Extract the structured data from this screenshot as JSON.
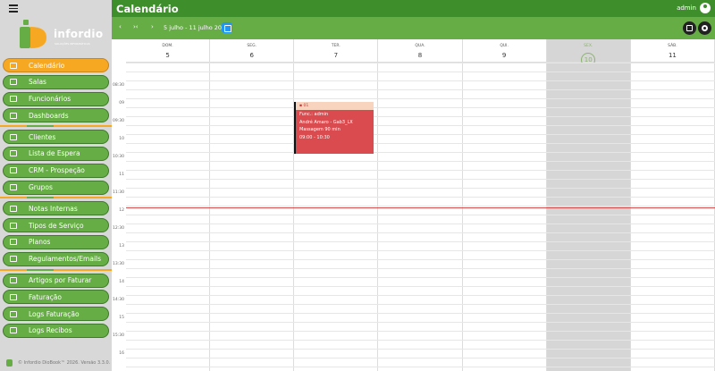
{
  "header": {
    "title": "Calendário",
    "user": "admin"
  },
  "toolbar": {
    "prev_icon": "chevron-left-icon",
    "today_icon": "collapse-icon",
    "next_icon": "chevron-right-icon",
    "range": "5 julho - 11 julho 2026"
  },
  "nav": [
    {
      "label": "Calendário",
      "active": true
    },
    {
      "label": "Salas"
    },
    {
      "label": "Funcionários"
    },
    {
      "label": "Dashboards"
    },
    {
      "label": "Clientes"
    },
    {
      "label": "Lista de Espera"
    },
    {
      "label": "CRM - Prospeção"
    },
    {
      "label": "Grupos"
    },
    {
      "label": "Notas Internas"
    },
    {
      "label": "Tipos de Serviço"
    },
    {
      "label": "Planos"
    },
    {
      "label": "Regulamentos/Emails"
    },
    {
      "label": "Artigos por Faturar"
    },
    {
      "label": "Faturação"
    },
    {
      "label": "Logs Faturação"
    },
    {
      "label": "Logs Recibos"
    }
  ],
  "logo": {
    "text": "infordio",
    "sub": "SOLUÇÕES INFORMÁTICAS"
  },
  "footer": {
    "text": "© Infordio DioBook™ 2026. Versão 3.3.0."
  },
  "days": [
    {
      "name": "DOM.",
      "num": "5"
    },
    {
      "name": "SEG.",
      "num": "6"
    },
    {
      "name": "TER.",
      "num": "7"
    },
    {
      "name": "QUA.",
      "num": "8"
    },
    {
      "name": "QUI.",
      "num": "9"
    },
    {
      "name": "SEX.",
      "num": "10",
      "today": true
    },
    {
      "name": "SÁB.",
      "num": "11"
    }
  ],
  "times": [
    "08:30",
    "09",
    "09:30",
    "10",
    "10:30",
    "11",
    "11:30",
    "12",
    "12:30",
    "13",
    "13:30",
    "14",
    "14:30",
    "15",
    "15:30",
    "16"
  ],
  "event": {
    "badge": "01",
    "func": "Func.: admin",
    "client": "André Amaro - Gab3_LX",
    "service": "Massagem 90 min",
    "time": "09:00 - 10:30"
  },
  "colors": {
    "primary": "#3e8e2b",
    "nav": "#67ad46",
    "active": "#f7a823",
    "event": "#d94b4e",
    "today": "#d6d6d6"
  }
}
